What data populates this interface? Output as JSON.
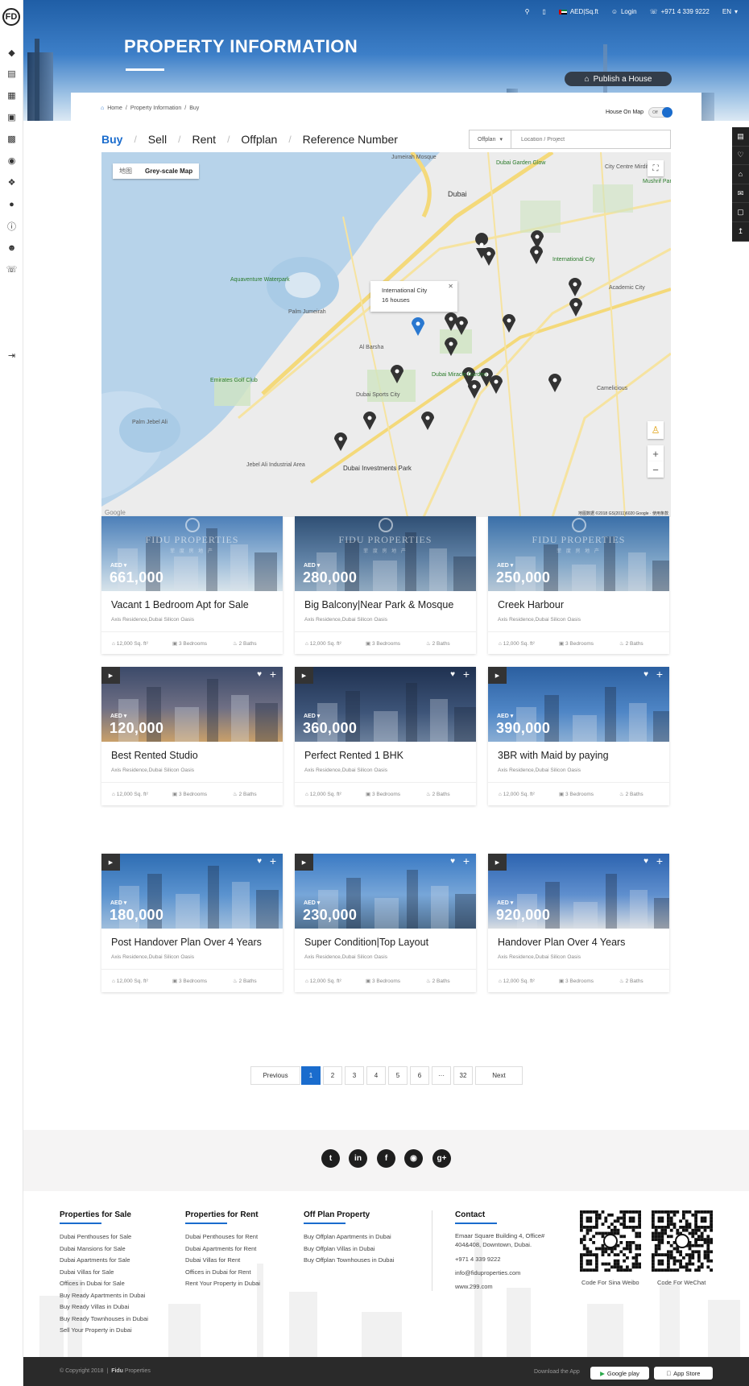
{
  "header": {
    "title": "PROPERTY INFORMATION",
    "currency_unit": "AED|Sq.ft",
    "login": "Login",
    "phone": "+971 4 339 9222",
    "lang": "EN",
    "publish_label": "Publish a House"
  },
  "sidebar": {
    "logo": "FD",
    "icons": [
      "tag-icon",
      "building-icon",
      "grid-icon",
      "office-icon",
      "chart-icon",
      "location-icon",
      "handshake-icon",
      "people-icon",
      "info-icon",
      "team-icon",
      "phone-icon",
      "collapse-icon"
    ]
  },
  "breadcrumb": [
    "Home",
    "Property Information",
    "Buy"
  ],
  "house_on_map": {
    "label": "House On Map",
    "state": "Off"
  },
  "tabs": [
    "Buy",
    "Sell",
    "Rent",
    "Offplan",
    "Reference Number"
  ],
  "search": {
    "select": "Offplan",
    "placeholder": "Location / Project"
  },
  "map": {
    "type_options": [
      "地图",
      "Grey-scale Map"
    ],
    "info_title": "International City",
    "info_count": "16 houses",
    "labels": [
      "Dubai",
      "Dubai Garden Glow",
      "City Centre Mirdif",
      "Mushrif Park",
      "Jumeirah Mosque",
      "Aquaventure Waterpark",
      "Palm Jumeirah",
      "Al Barsha",
      "Dubai Miracle Garden",
      "Dubai Sports City",
      "Dubai Investments Park",
      "Palm Jebel Ali",
      "International City",
      "Camelicious",
      "Academic City",
      "Emirates Golf Club",
      "Jebel Ali Industrial Area"
    ],
    "copyright": "地图数据 ©2018 GS(2011)6020 Google · 使用条款",
    "google": "Google"
  },
  "listings": [
    {
      "price": "661,000",
      "title": "Vacant 1 Bedroom Apt for Sale",
      "watermark": true
    },
    {
      "price": "280,000",
      "title": "Big Balcony|Near Park & Mosque",
      "watermark": true
    },
    {
      "price": "250,000",
      "title": "Creek Harbour",
      "watermark": true
    },
    {
      "price": "120,000",
      "title": "Best Rented Studio",
      "watermark": false
    },
    {
      "price": "360,000",
      "title": "Perfect Rented 1 BHK",
      "watermark": false
    },
    {
      "price": "390,000",
      "title": "3BR with Maid by paying",
      "watermark": false
    },
    {
      "price": "180,000",
      "title": "Post Handover Plan Over 4 Years",
      "watermark": false
    },
    {
      "price": "230,000",
      "title": "Super Condition|Top Layout",
      "watermark": false
    },
    {
      "price": "920,000",
      "title": "Handover Plan Over 4 Years",
      "watermark": false
    }
  ],
  "listing_common": {
    "currency": "AED",
    "address": "Axis Residence,Dubai Silicon Oasis",
    "area": "12,000 Sq. ft²",
    "bedrooms": "3 Bedrooms",
    "baths": "2 Baths",
    "watermark_brand": "FIDU PROPERTIES",
    "watermark_sub": "菲 度 房 地 产"
  },
  "pagination": [
    "Previous",
    "1",
    "2",
    "3",
    "4",
    "5",
    "6",
    "···",
    "32",
    "Next"
  ],
  "footer": {
    "social": [
      "twitter-icon",
      "linkedin-icon",
      "facebook-icon",
      "instagram-icon",
      "googleplus-icon"
    ],
    "sale_title": "Properties for Sale",
    "sale_links": [
      "Dubai Penthouses for Sale",
      "Dubai Mansions for Sale",
      "Dubai Apartments for Sale",
      "Dubai Villas for Sale",
      "Offices in Dubai for Sale",
      "Buy Ready Apartments in Dubai",
      "Buy Ready Villas in Dubai",
      "Buy Ready Townhouses in Dubai",
      "Sell Your Property in Dubai"
    ],
    "rent_title": "Properties for Rent",
    "rent_links": [
      "Dubai Penthouses for Rent",
      "Dubai Apartments for Rent",
      "Dubai Villas for Rent",
      "Offices in Dubai for Rent",
      "Rent Your Property in Dubai"
    ],
    "offplan_title": "Off Plan Property",
    "offplan_links": [
      "Buy Offplan Apartments in Dubai",
      "Buy Offplan Villas in Dubai",
      "Buy Offplan Townhouses in Dubai"
    ],
    "contact_title": "Contact",
    "contact_address_1": "Emaar Square Building 4, Office#",
    "contact_address_2": "404&408, Downtown, Dubai.",
    "contact_phone": "+971 4 339 9222",
    "contact_email": "info@fiduproperties.com",
    "contact_web": "www.299.com",
    "qr_weibo": "Code For Sina Weibo",
    "qr_wechat": "Code For  WeChat",
    "copyright": "© Copyright 2018",
    "brand_bold": "Fidu",
    "brand_rest": "Properties",
    "download": "Download the App",
    "google_play": "Google play",
    "app_store": "App Store"
  },
  "rightbar": [
    "building-icon",
    "heart-icon",
    "home-icon",
    "chat-icon",
    "message-icon",
    "top-icon"
  ]
}
